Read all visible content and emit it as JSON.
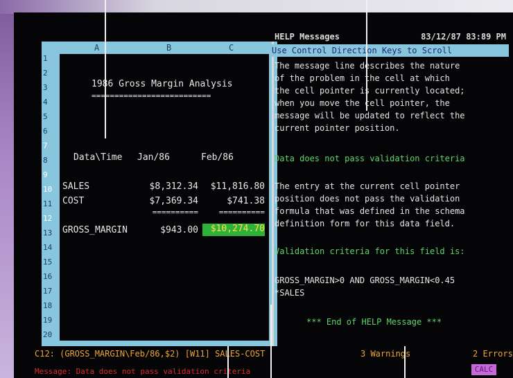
{
  "spreadsheet": {
    "columns": [
      "A",
      "B",
      "C"
    ],
    "rows": [
      "1",
      "2",
      "3",
      "4",
      "5",
      "6",
      "7",
      "8",
      "9",
      "10",
      "11",
      "12",
      "13",
      "14",
      "15",
      "16",
      "17",
      "18",
      "19",
      "20"
    ],
    "marked_rows": [
      "7",
      "9",
      "10",
      "12"
    ],
    "title": "1986 Gross Margin Analysis",
    "title_rule": "==========================",
    "header": {
      "label": "Data\\Time",
      "jan": "Jan/86",
      "feb": "Feb/86"
    },
    "sales": {
      "label": "SALES",
      "jan": "$8,312.34",
      "feb": "$11,816.80"
    },
    "cost": {
      "label": "COST",
      "jan": "$7,369.34",
      "feb": "$741.38"
    },
    "rule_jan": "==========",
    "rule_feb": "==========",
    "margin": {
      "label": "GROSS_MARGIN",
      "jan": "$943.00",
      "feb": "$10,274.70"
    }
  },
  "help": {
    "title": "HELP Messages",
    "timestamp": "83/12/87 83:89 PM",
    "instruction": "Use Control Direction Keys to Scroll",
    "paragraph1": [
      "The message line describes the nature",
      "of the problem in the cell at which",
      "the cell pointer is currently located;",
      "when you move the cell pointer, the",
      "message will be updated to reflect the",
      "current pointer position."
    ],
    "error_heading": "Data does not pass validation criteria",
    "paragraph2": [
      "The entry at the current cell pointer",
      "position does not pass the validation",
      "formula that was defined in the schema",
      "definition form for this data field."
    ],
    "criteria_heading": "Validation criteria for this field is:",
    "criteria": [
      "GROSS_MARGIN>0 AND GROSS_MARGIN<0.45",
      "*SALES"
    ],
    "end_marker": "*** End of HELP Message ***"
  },
  "status": {
    "cell_line": "C12: (GROSS_MARGIN\\Feb/86,$2) [W11] SALES-COST",
    "warnings": "3 Warnings",
    "errors": "2 Errors",
    "message": "Message: Data does not pass validation criteria",
    "mode": "CALC"
  },
  "colors": {
    "screen": "#050508",
    "grid_border": "#88c6de",
    "help_heading": "#5fd46a",
    "status_text": "#f2a530",
    "message_text": "#d42f2f",
    "active_cell": "#2fb23a"
  }
}
